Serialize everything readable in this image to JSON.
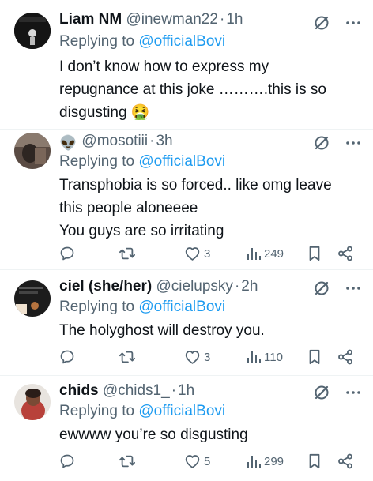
{
  "replies": [
    {
      "name": "Liam NM",
      "handle": "@inewman22",
      "dot": "·",
      "time": "1h",
      "replying_prefix": "Replying to ",
      "replying_to": "@officialBovi",
      "text_lines": [
        "I don’t know how to express my",
        "repugnance at this joke ……….this is so",
        "disgusting 🤮"
      ],
      "counts": null
    },
    {
      "name": "",
      "name_emoji": "👽",
      "handle": "@mosotiii",
      "dot": "·",
      "time": "3h",
      "replying_prefix": "Replying to ",
      "replying_to": "@officialBovi",
      "text_lines": [
        "Transphobia is so forced.. like omg leave",
        "this people aloneeee",
        "You guys are so irritating"
      ],
      "counts": {
        "reply": "",
        "repost": "",
        "like": "3",
        "views": "249"
      }
    },
    {
      "name": "ciel (she/her)",
      "handle": "@cielupsky",
      "dot": "·",
      "time": "2h",
      "replying_prefix": "Replying to ",
      "replying_to": "@officialBovi",
      "text_lines": [
        "The holyghost will destroy you."
      ],
      "counts": {
        "reply": "",
        "repost": "",
        "like": "3",
        "views": "110"
      }
    },
    {
      "name": "chids",
      "handle": "@chids1_",
      "dot": "·",
      "time": "1h",
      "replying_prefix": "Replying to ",
      "replying_to": "@officialBovi",
      "text_lines": [
        "ewwww you’re so disgusting"
      ],
      "counts": {
        "reply": "",
        "repost": "",
        "like": "5",
        "views": "299"
      }
    }
  ],
  "icons": {
    "reply": "reply-icon",
    "repost": "repost-icon",
    "like": "heart-icon",
    "views": "views-icon",
    "bookmark": "bookmark-icon",
    "share": "share-icon",
    "grok": "grok-icon",
    "more": "more-icon"
  },
  "colors": {
    "text": "#0f1419",
    "muted": "#536471",
    "link": "#1d9bf0",
    "divider": "#eff3f4"
  }
}
